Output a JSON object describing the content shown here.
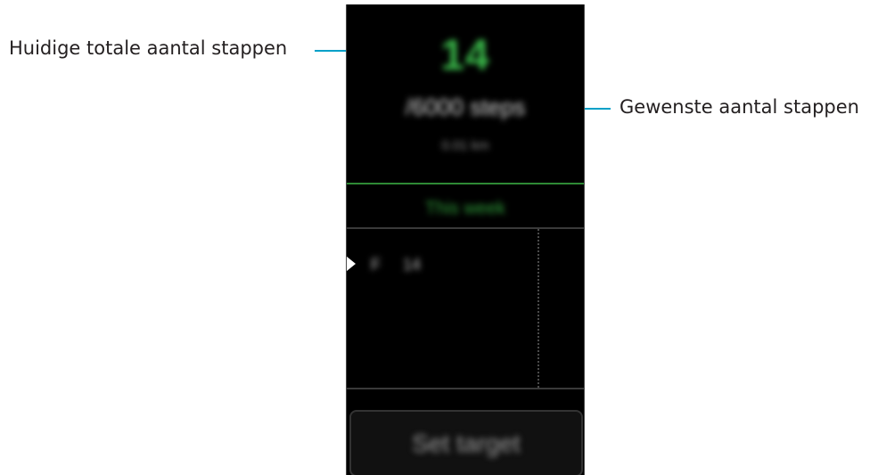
{
  "callouts": {
    "current_total_steps": "Huidige totale aantal stappen",
    "target_steps": "Gewenste aantal stappen"
  },
  "screen": {
    "current_steps": "14",
    "target_text": "/6000 steps",
    "distance_text": "0.01 km",
    "period_label": "This week",
    "day_rows": [
      {
        "day": "F",
        "steps": "14"
      }
    ],
    "set_target_label": "Set target"
  },
  "colors": {
    "accent_green": "#3ab84a",
    "callout_line": "#00a0c8",
    "screen_background": "#000000"
  }
}
